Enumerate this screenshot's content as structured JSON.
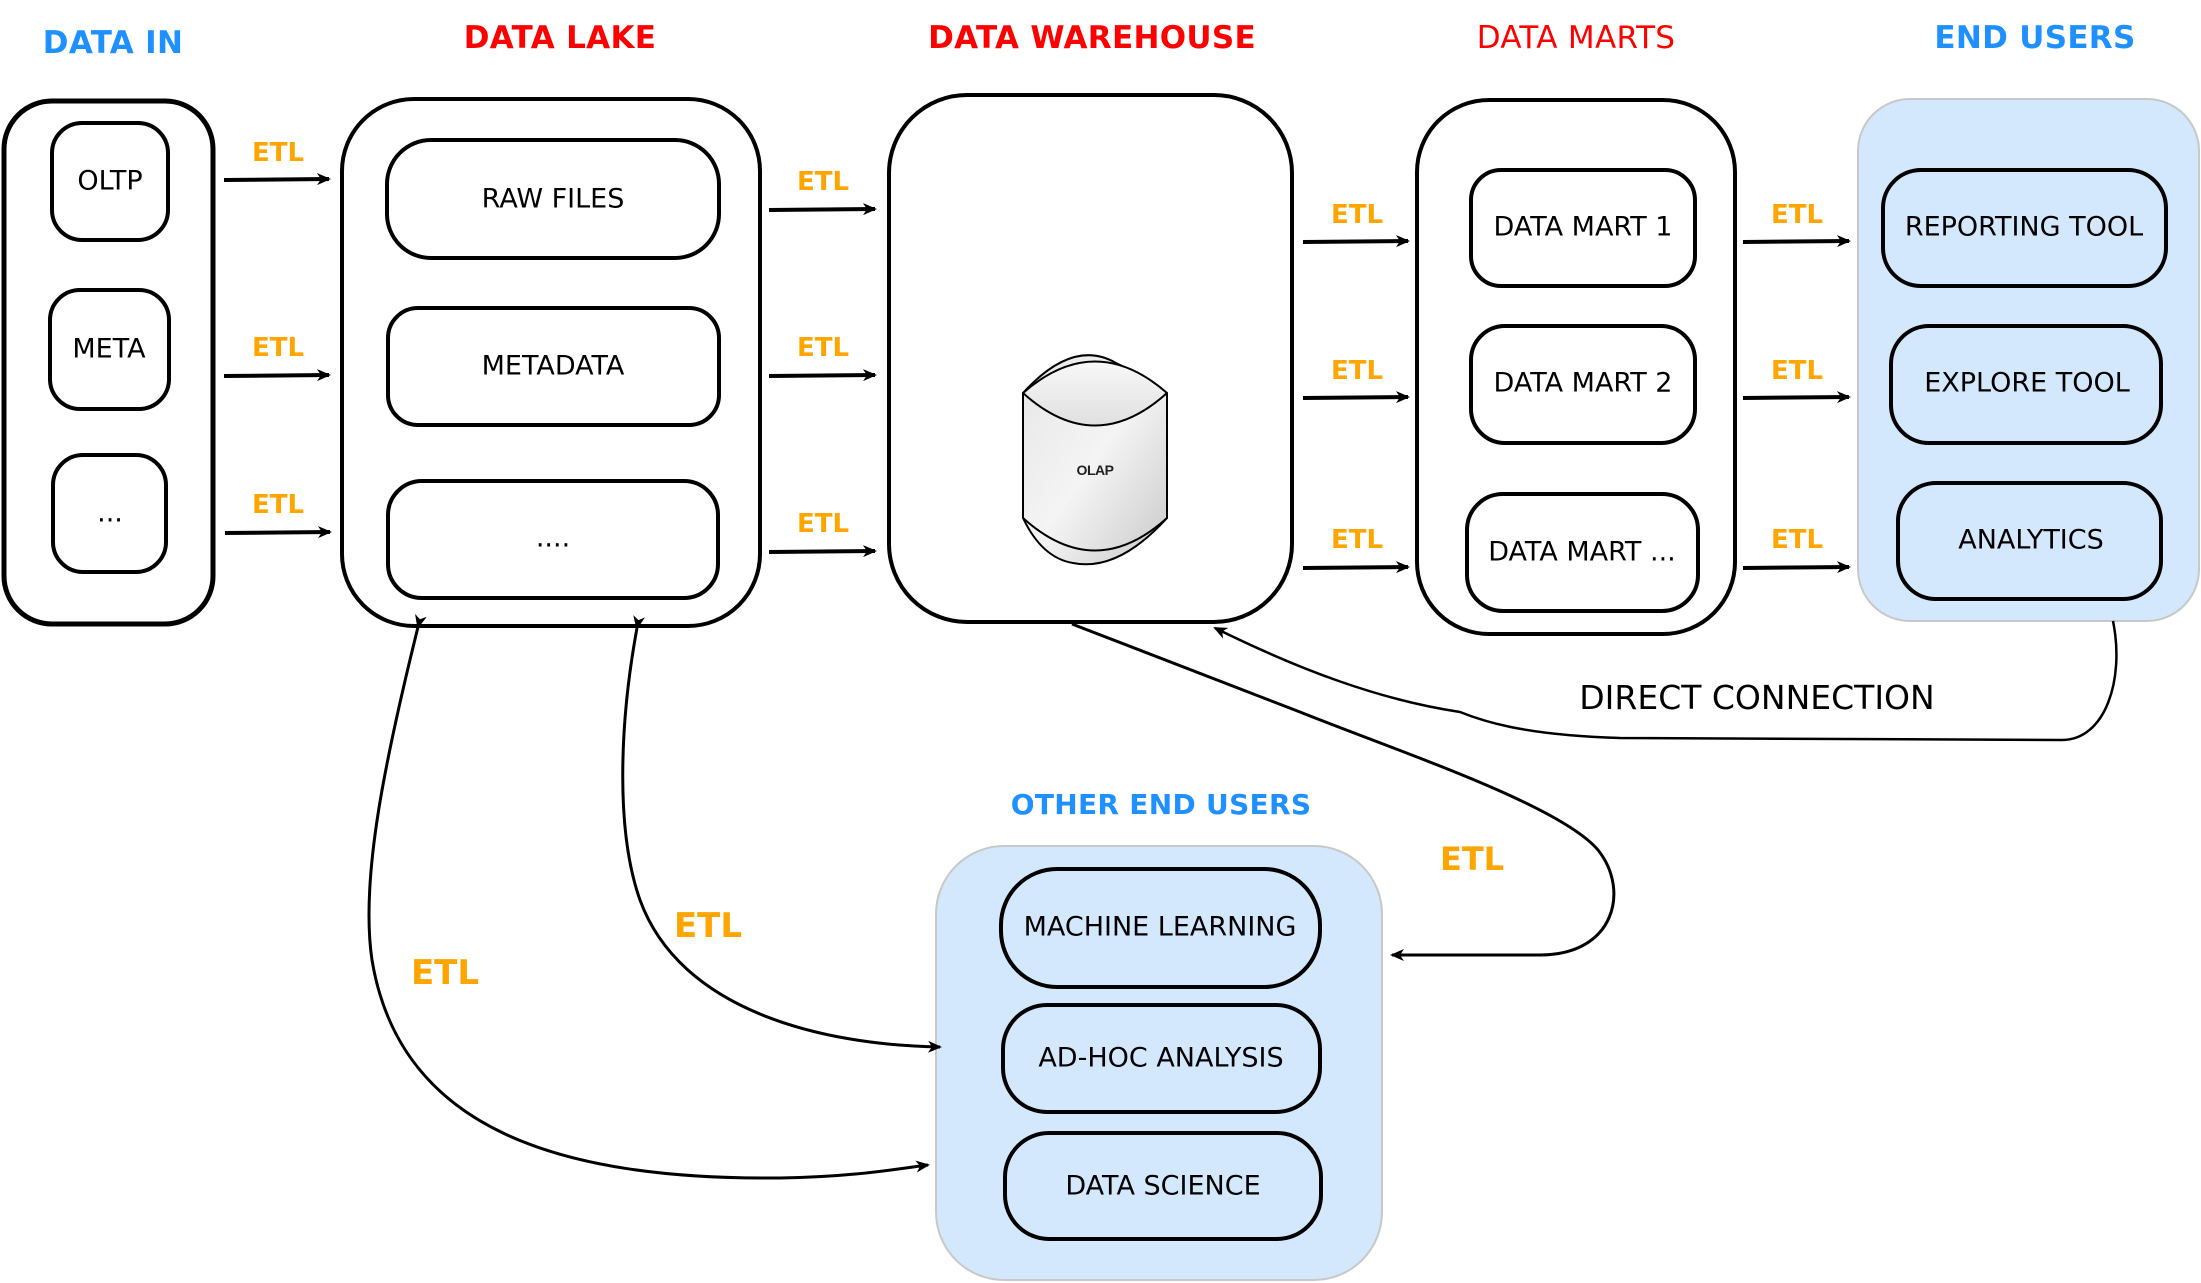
{
  "colors": {
    "title_blue": "#1e90ff",
    "title_red": "#ff0000",
    "etl_orange": "#ffa500",
    "user_panel_fill": "#d3e8fc",
    "user_panel_border": "#c8c8c8",
    "stroke": "#000000"
  },
  "sections": {
    "data_in": {
      "title": "DATA IN",
      "items": [
        "OLTP",
        "META",
        "..."
      ]
    },
    "data_lake": {
      "title": "DATA LAKE",
      "items": [
        "RAW FILES",
        "METADATA",
        "...."
      ]
    },
    "data_warehouse": {
      "title": "DATA WAREHOUSE",
      "store": {
        "label": "OLAP",
        "icon": "database-cylinder-icon"
      }
    },
    "data_marts": {
      "title": "DATA MARTS",
      "items": [
        "DATA MART 1",
        "DATA MART 2",
        "DATA MART ..."
      ]
    },
    "end_users": {
      "title": "END USERS",
      "items": [
        "REPORTING TOOL",
        "EXPLORE TOOL",
        "ANALYTICS"
      ]
    },
    "other_end_users": {
      "title": "OTHER END USERS",
      "items": [
        "MACHINE LEARNING",
        "AD-HOC ANALYSIS",
        "DATA SCIENCE"
      ]
    }
  },
  "edge_labels": {
    "etl": "ETL",
    "direct_connection": "DIRECT CONNECTION"
  },
  "edges": [
    {
      "from": "OLTP",
      "to": "DATA LAKE",
      "label": "ETL"
    },
    {
      "from": "META",
      "to": "DATA LAKE",
      "label": "ETL"
    },
    {
      "from": "...",
      "to": "DATA LAKE",
      "label": "ETL"
    },
    {
      "from": "DATA LAKE",
      "to": "DATA WAREHOUSE",
      "label": "ETL"
    },
    {
      "from": "DATA LAKE",
      "to": "DATA WAREHOUSE",
      "label": "ETL"
    },
    {
      "from": "DATA LAKE",
      "to": "DATA WAREHOUSE",
      "label": "ETL"
    },
    {
      "from": "DATA WAREHOUSE",
      "to": "DATA MART 1",
      "label": "ETL"
    },
    {
      "from": "DATA WAREHOUSE",
      "to": "DATA MART 2",
      "label": "ETL"
    },
    {
      "from": "DATA WAREHOUSE",
      "to": "DATA MART ...",
      "label": "ETL"
    },
    {
      "from": "DATA MART 1",
      "to": "REPORTING TOOL",
      "label": "ETL"
    },
    {
      "from": "DATA MART 2",
      "to": "EXPLORE TOOL",
      "label": "ETL"
    },
    {
      "from": "DATA MART ...",
      "to": "ANALYTICS",
      "label": "ETL"
    },
    {
      "from": "END USERS",
      "to": "DATA WAREHOUSE",
      "label": "DIRECT CONNECTION"
    },
    {
      "from": "DATA WAREHOUSE",
      "to": "OTHER END USERS",
      "label": "ETL"
    },
    {
      "from": "DATA LAKE",
      "to": "OTHER END USERS",
      "label": "ETL",
      "bidirectional": true
    },
    {
      "from": "DATA LAKE",
      "to": "OTHER END USERS",
      "label": "ETL",
      "bidirectional": true
    }
  ]
}
